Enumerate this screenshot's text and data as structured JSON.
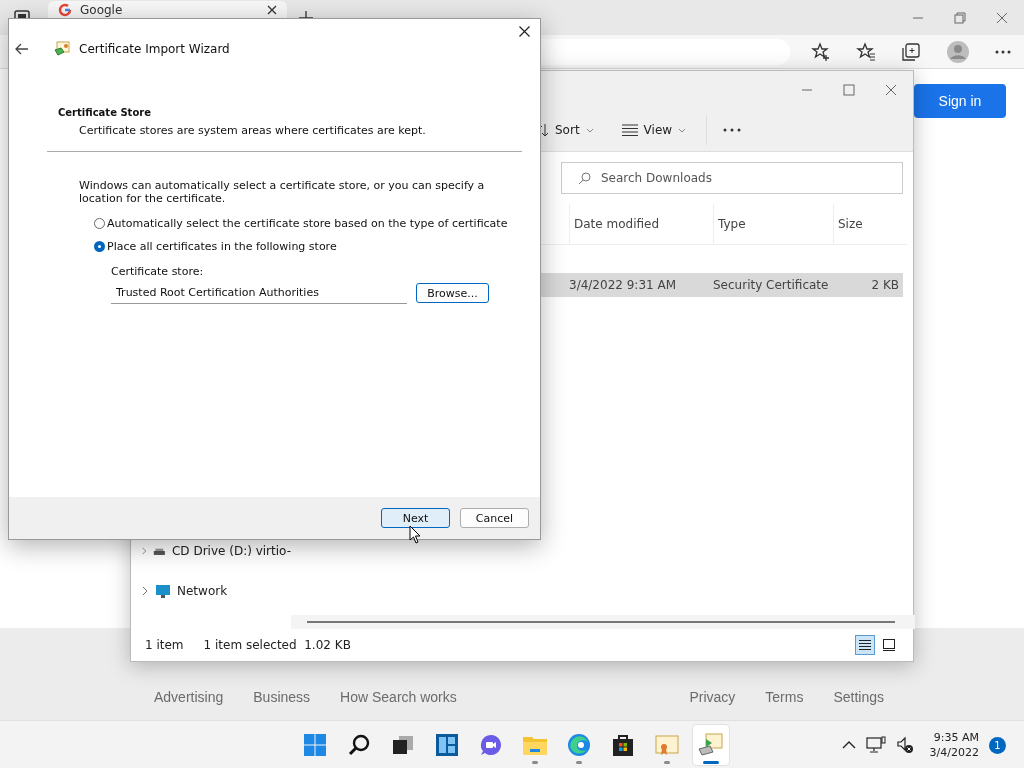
{
  "browser": {
    "tab": {
      "title": "Google"
    },
    "sign_in": "Sign in",
    "footer_left": [
      "Advertising",
      "Business",
      "How Search works"
    ],
    "footer_right": [
      "Privacy",
      "Terms",
      "Settings"
    ]
  },
  "explorer": {
    "toolbar": [
      {
        "label": "Sort",
        "kind": "sort"
      },
      {
        "label": "View",
        "kind": "view"
      }
    ],
    "search": {
      "placeholder": "Search Downloads"
    },
    "columns": [
      "Date modified",
      "Type",
      "Size"
    ],
    "rows": [
      {
        "date_modified": "3/4/2022 9:31 AM",
        "type": "Security Certificate",
        "size": "2 KB",
        "selected": true
      }
    ],
    "nav": [
      {
        "label": "CD Drive (D:) virtio-",
        "kind": "drive"
      },
      {
        "label": "Network",
        "kind": "network"
      }
    ],
    "status": {
      "count": "1 item",
      "selection": "1 item selected",
      "size": "1.02 KB"
    },
    "views": [
      {
        "kind": "details",
        "selected": true
      },
      {
        "kind": "tiles",
        "selected": false
      }
    ]
  },
  "dialog": {
    "title": "Certificate Import Wizard",
    "heading": "Certificate Store",
    "subheading": "Certificate stores are system areas where certificates are kept.",
    "description": "Windows can automatically select a certificate store, or you can specify a location for the certificate.",
    "options": [
      {
        "label": "Automatically select the certificate store based on the type of certificate",
        "selected": false
      },
      {
        "label": "Place all certificates in the following store",
        "selected": true
      }
    ],
    "store_label": "Certificate store:",
    "store_value": "Trusted Root Certification Authorities",
    "browse": "Browse...",
    "buttons": [
      {
        "label": "Next",
        "default": true
      },
      {
        "label": "Cancel",
        "default": false
      }
    ]
  },
  "taskbar": {
    "apps": [
      {
        "kind": "start",
        "open": false,
        "selected": false
      },
      {
        "kind": "search",
        "open": false,
        "selected": false
      },
      {
        "kind": "taskview",
        "open": false,
        "selected": false
      },
      {
        "kind": "widgets",
        "open": false,
        "selected": false
      },
      {
        "kind": "chat",
        "open": false,
        "selected": false
      },
      {
        "kind": "explorer",
        "open": true,
        "selected": false
      },
      {
        "kind": "edge",
        "open": true,
        "selected": false
      },
      {
        "kind": "store",
        "open": false,
        "selected": false
      },
      {
        "kind": "certificate",
        "open": true,
        "selected": false
      },
      {
        "kind": "wizard",
        "open": true,
        "selected": true
      }
    ],
    "time": "9:35 AM",
    "date": "3/4/2022",
    "notifications": "1"
  }
}
